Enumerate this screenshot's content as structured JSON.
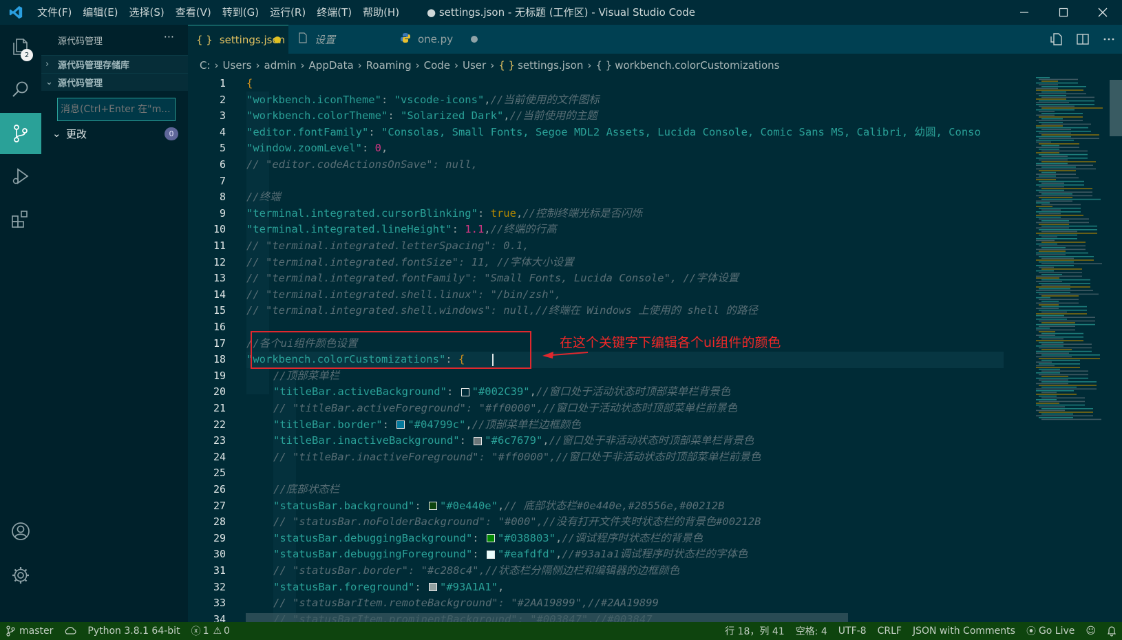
{
  "window": {
    "title": "● settings.json - 无标题 (工作区) - Visual Studio Code",
    "menu": [
      "文件(F)",
      "编辑(E)",
      "选择(S)",
      "查看(V)",
      "转到(G)",
      "运行(R)",
      "终端(T)",
      "帮助(H)"
    ]
  },
  "activity": {
    "explorer_badge": "2"
  },
  "sidebar": {
    "header": "源代码管理",
    "more": "···",
    "section_repos": "源代码管理存储库",
    "section_scm": "源代码管理",
    "message_placeholder": "消息(Ctrl+Enter 在\"m...",
    "changes_label": "更改",
    "changes_count": "0"
  },
  "tabs": [
    {
      "label": "settings.json",
      "icon": "{ }"
    },
    {
      "label": "设置"
    },
    {
      "label": "one.py"
    }
  ],
  "breadcrumb": [
    "C:",
    "Users",
    "admin",
    "AppData",
    "Roaming",
    "Code",
    "User",
    "settings.json",
    "workbench.colorCustomizations"
  ],
  "editor": {
    "lines": [
      {
        "n": "1",
        "indent": 0,
        "parts": [
          [
            "brace",
            "{"
          ]
        ]
      },
      {
        "n": "2",
        "indent": 1,
        "parts": [
          [
            "k",
            "\"workbench.iconTheme\""
          ],
          [
            "p",
            ": "
          ],
          [
            "v",
            "\"vscode-icons\""
          ],
          [
            "p",
            ","
          ],
          [
            "cm",
            "//当前使用的文件图标"
          ]
        ]
      },
      {
        "n": "3",
        "indent": 1,
        "parts": [
          [
            "k",
            "\"workbench.colorTheme\""
          ],
          [
            "p",
            ": "
          ],
          [
            "v",
            "\"Solarized Dark\""
          ],
          [
            "p",
            ","
          ],
          [
            "cm",
            "//当前使用的主题"
          ]
        ]
      },
      {
        "n": "4",
        "indent": 1,
        "parts": [
          [
            "k",
            "\"editor.fontFamily\""
          ],
          [
            "p",
            ": "
          ],
          [
            "v",
            "\"Consolas, Small Fonts, Segoe MDL2 Assets, Lucida Console, Comic Sans MS, Calibri, 幼圆, Conso"
          ]
        ]
      },
      {
        "n": "5",
        "indent": 1,
        "parts": [
          [
            "k",
            "\"window.zoomLevel\""
          ],
          [
            "p",
            ": "
          ],
          [
            "num",
            "0"
          ],
          [
            "p",
            ","
          ]
        ]
      },
      {
        "n": "6",
        "indent": 1,
        "parts": [
          [
            "cm",
            "// \"editor.codeActionsOnSave\": null,"
          ]
        ]
      },
      {
        "n": "7",
        "indent": 1,
        "parts": []
      },
      {
        "n": "8",
        "indent": 1,
        "parts": [
          [
            "cm",
            "//终端"
          ]
        ]
      },
      {
        "n": "9",
        "indent": 1,
        "parts": [
          [
            "k",
            "\"terminal.integrated.cursorBlinking\""
          ],
          [
            "p",
            ": "
          ],
          [
            "bool",
            "true"
          ],
          [
            "p",
            ","
          ],
          [
            "cm",
            "//控制终端光标是否闪烁"
          ]
        ]
      },
      {
        "n": "10",
        "indent": 1,
        "parts": [
          [
            "k",
            "\"terminal.integrated.lineHeight\""
          ],
          [
            "p",
            ": "
          ],
          [
            "num",
            "1.1"
          ],
          [
            "p",
            ","
          ],
          [
            "cm",
            "//终端的行高"
          ]
        ]
      },
      {
        "n": "11",
        "indent": 1,
        "parts": [
          [
            "cm",
            "// \"terminal.integrated.letterSpacing\": 0.1,"
          ]
        ]
      },
      {
        "n": "12",
        "indent": 1,
        "parts": [
          [
            "cm",
            "// \"terminal.integrated.fontSize\": 11, //字体大小设置"
          ]
        ]
      },
      {
        "n": "13",
        "indent": 1,
        "parts": [
          [
            "cm",
            "// \"terminal.integrated.fontFamily\": \"Small Fonts, Lucida Console\", //字体设置"
          ]
        ]
      },
      {
        "n": "14",
        "indent": 1,
        "parts": [
          [
            "cm",
            "// \"terminal.integrated.shell.linux\": \"/bin/zsh\","
          ]
        ]
      },
      {
        "n": "15",
        "indent": 1,
        "parts": [
          [
            "cm",
            "// \"terminal.integrated.shell.windows\": null,//终端在 Windows 上使用的 shell 的路径"
          ]
        ]
      },
      {
        "n": "16",
        "indent": 1,
        "parts": []
      },
      {
        "n": "17",
        "indent": 1,
        "parts": [
          [
            "cm",
            "//各个ui组件颜色设置"
          ]
        ]
      },
      {
        "n": "18",
        "indent": 1,
        "parts": [
          [
            "k",
            "\"workbench.colorCustomizations\""
          ],
          [
            "p",
            ": "
          ],
          [
            "brace",
            "{"
          ]
        ]
      },
      {
        "n": "19",
        "indent": 2,
        "parts": [
          [
            "cm",
            "//顶部菜单栏"
          ]
        ]
      },
      {
        "n": "20",
        "indent": 2,
        "parts": [
          [
            "k",
            "\"titleBar.activeBackground\""
          ],
          [
            "p",
            ": "
          ],
          [
            "sw",
            "#002C39"
          ],
          [
            "v",
            "\"#002C39\""
          ],
          [
            "p",
            ","
          ],
          [
            "cm",
            "//窗口处于活动状态时顶部菜单栏背景色"
          ]
        ]
      },
      {
        "n": "21",
        "indent": 2,
        "parts": [
          [
            "cm",
            "// \"titleBar.activeForeground\": \"#ff0000\",//窗口处于活动状态时顶部菜单栏前景色"
          ]
        ]
      },
      {
        "n": "22",
        "indent": 2,
        "parts": [
          [
            "k",
            "\"titleBar.border\""
          ],
          [
            "p",
            ": "
          ],
          [
            "sw",
            "#04799c"
          ],
          [
            "v",
            "\"#04799c\""
          ],
          [
            "p",
            ","
          ],
          [
            "cm",
            "//顶部菜单栏边框颜色"
          ]
        ]
      },
      {
        "n": "23",
        "indent": 2,
        "parts": [
          [
            "k",
            "\"titleBar.inactiveBackground\""
          ],
          [
            "p",
            ": "
          ],
          [
            "sw",
            "#6c7679"
          ],
          [
            "v",
            "\"#6c7679\""
          ],
          [
            "p",
            ","
          ],
          [
            "cm",
            "//窗口处于非活动状态时顶部菜单栏背景色"
          ]
        ]
      },
      {
        "n": "24",
        "indent": 2,
        "parts": [
          [
            "cm",
            "// \"titleBar.inactiveForeground\": \"#ff0000\",//窗口处于非活动状态时顶部菜单栏前景色"
          ]
        ]
      },
      {
        "n": "25",
        "indent": 2,
        "parts": []
      },
      {
        "n": "26",
        "indent": 2,
        "parts": [
          [
            "cm",
            "//底部状态栏"
          ]
        ]
      },
      {
        "n": "27",
        "indent": 2,
        "parts": [
          [
            "k",
            "\"statusBar.background\""
          ],
          [
            "p",
            ": "
          ],
          [
            "sw",
            "#0e440e"
          ],
          [
            "v",
            "\"#0e440e\""
          ],
          [
            "p",
            ","
          ],
          [
            "cm",
            "// 底部状态栏#0e440e,#28556e,#00212B"
          ]
        ]
      },
      {
        "n": "28",
        "indent": 2,
        "parts": [
          [
            "cm",
            "// \"statusBar.noFolderBackground\": \"#000\",//没有打开文件夹时状态栏的背景色#00212B"
          ]
        ]
      },
      {
        "n": "29",
        "indent": 2,
        "parts": [
          [
            "k",
            "\"statusBar.debuggingBackground\""
          ],
          [
            "p",
            ": "
          ],
          [
            "sw",
            "#038803"
          ],
          [
            "v",
            "\"#038803\""
          ],
          [
            "p",
            ","
          ],
          [
            "cm",
            "//调试程序时状态栏的背景色"
          ]
        ]
      },
      {
        "n": "30",
        "indent": 2,
        "parts": [
          [
            "k",
            "\"statusBar.debuggingForeground\""
          ],
          [
            "p",
            ": "
          ],
          [
            "sw",
            "#eafdfd"
          ],
          [
            "v",
            "\"#eafdfd\""
          ],
          [
            "p",
            ","
          ],
          [
            "cm",
            "//#93a1a1调试程序时状态栏的字体色"
          ]
        ]
      },
      {
        "n": "31",
        "indent": 2,
        "parts": [
          [
            "cm",
            "// \"statusBar.border\": \"#c288c4\",//状态栏分隔侧边栏和编辑器的边框颜色"
          ]
        ]
      },
      {
        "n": "32",
        "indent": 2,
        "parts": [
          [
            "k",
            "\"statusBar.foreground\""
          ],
          [
            "p",
            ": "
          ],
          [
            "sw",
            "#93A1A1"
          ],
          [
            "v",
            "\"#93A1A1\""
          ],
          [
            "p",
            ","
          ]
        ]
      },
      {
        "n": "33",
        "indent": 2,
        "parts": [
          [
            "cm",
            "// \"statusBarItem.remoteBackground\": \"#2AA19899\",//#2AA19899"
          ]
        ]
      },
      {
        "n": "34",
        "indent": 2,
        "parts": [
          [
            "cm",
            "// \"statusBarItem.prominentBackground\": \"#003847\",//#003847"
          ]
        ]
      }
    ]
  },
  "annotation": {
    "text": "在这个关键字下编辑各个ui组件的颜色"
  },
  "statusbar": {
    "branch": "master",
    "python": "Python 3.8.1 64-bit",
    "errors": "1",
    "warnings": "0",
    "position": "行 18，列 41",
    "spaces": "空格: 4",
    "encoding": "UTF-8",
    "eol": "CRLF",
    "language": "JSON with Comments",
    "golive": "Go Live"
  },
  "colors": {
    "accent": "#2aa198",
    "status_bg": "#0e440e",
    "annotation": "#e0282e",
    "modified_dot": "#e0c020"
  }
}
